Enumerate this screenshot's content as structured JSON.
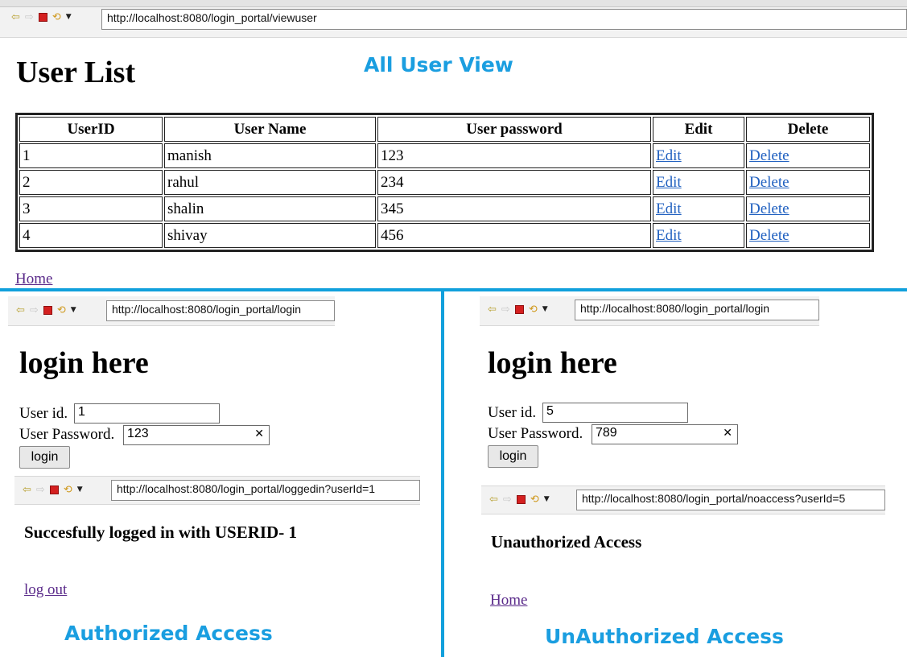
{
  "top": {
    "url": "http://localhost:8080/login_portal/viewuser",
    "heading": "User List",
    "caption": "All User View",
    "table": {
      "headers": [
        "UserID",
        "User Name",
        "User password",
        "Edit",
        "Delete"
      ],
      "rows": [
        {
          "id": "1",
          "name": "manish",
          "password": "123",
          "edit": "Edit",
          "delete": "Delete"
        },
        {
          "id": "2",
          "name": "rahul",
          "password": "234",
          "edit": "Edit",
          "delete": "Delete"
        },
        {
          "id": "3",
          "name": "shalin",
          "password": "345",
          "edit": "Edit",
          "delete": "Delete"
        },
        {
          "id": "4",
          "name": "shivay",
          "password": "456",
          "edit": "Edit",
          "delete": "Delete"
        }
      ]
    },
    "home_link": "Home"
  },
  "left": {
    "login_url": "http://localhost:8080/login_portal/login",
    "heading": "login here",
    "userid_label": "User id.",
    "userid_value": "1",
    "password_label": "User Password.",
    "password_value": "123",
    "login_button": "login",
    "result_url": "http://localhost:8080/login_portal/loggedin?userId=1",
    "result_message": "Succesfully logged in with USERID- 1",
    "logout_link": "log out",
    "caption": "Authorized Access"
  },
  "right": {
    "login_url": "http://localhost:8080/login_portal/login",
    "heading": "login here",
    "userid_label": "User id.",
    "userid_value": "5",
    "password_label": "User Password.",
    "password_value": "789",
    "login_button": "login",
    "result_url": "http://localhost:8080/login_portal/noaccess?userId=5",
    "result_message": "Unauthorized Access",
    "home_link": "Home",
    "caption": "UnAuthorized Access"
  },
  "icons": {
    "back": "back-arrow-icon",
    "forward": "forward-arrow-icon",
    "stop": "stop-icon",
    "refresh": "refresh-icon",
    "menu": "chevron-down-icon",
    "clear": "clear-x-icon"
  },
  "colors": {
    "caption": "#1a9ee0",
    "divider": "#11a0dc",
    "link": "#2060c0",
    "visited_link": "#5a2a8a"
  }
}
